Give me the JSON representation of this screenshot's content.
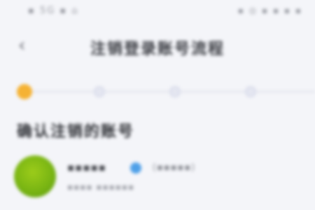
{
  "status_bar": {
    "left_text": "▪ 5G ▪ ⌂",
    "right_text": "▪ ◎ ▪ ▪ ▪ ▪"
  },
  "nav": {
    "back_glyph": "‹",
    "title": "注销登录账号流程"
  },
  "stepper": {
    "total_steps": 4,
    "current_step": 1,
    "active_color": "#f5b233"
  },
  "section": {
    "heading": "确认注销的账号"
  },
  "account": {
    "name": "▪▪▪▪▪",
    "tag": "(▪▪▪▪▪)",
    "subtitle": "▪▪▪▪ ▪▪▪▪▪▪",
    "verified_color": "#4fa0e8",
    "avatar_color": "#79b513"
  }
}
